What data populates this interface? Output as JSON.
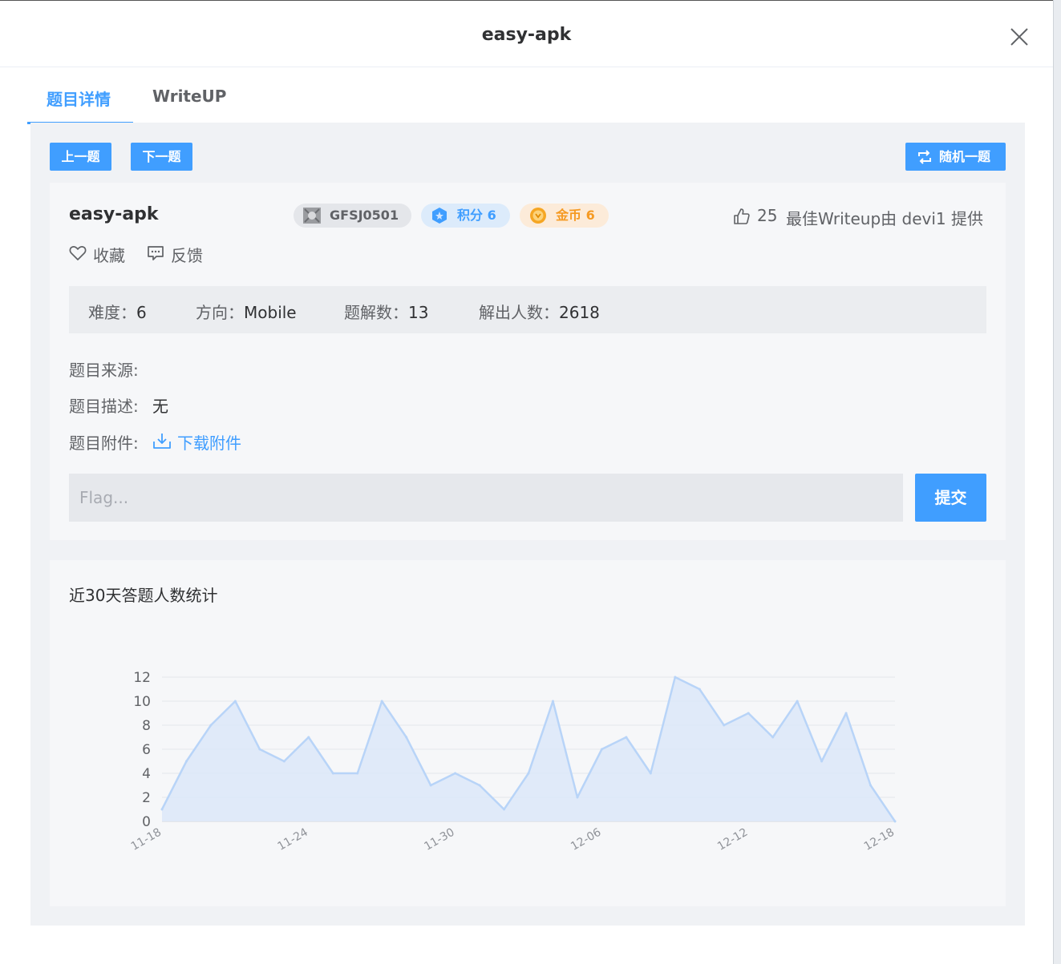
{
  "modal": {
    "title": "easy-apk",
    "close_icon": "close-icon"
  },
  "tabs": [
    {
      "label": "题目详情",
      "active": true
    },
    {
      "label": "WriteUP",
      "active": false
    }
  ],
  "toolbar": {
    "prev_label": "上一题",
    "next_label": "下一题",
    "random_label": "随机一题",
    "random_icon": "shuffle-icon"
  },
  "challenge": {
    "title": "easy-apk",
    "id_tag": "GFSJ0501",
    "score_tag": "积分 6",
    "coin_tag": "金币 6",
    "likes": "25",
    "writeup_credit": "最佳Writeup由 devi1 提供",
    "favorite_label": "收藏",
    "feedback_label": "反馈",
    "info": {
      "difficulty_label": "难度：",
      "difficulty": "6",
      "direction_label": "方向：",
      "direction": "Mobile",
      "solutions_label": "题解数：",
      "solutions": "13",
      "solvers_label": "解出人数：",
      "solvers": "2618"
    },
    "source_label": "题目来源:",
    "source": "",
    "description_label": "题目描述:",
    "description": "无",
    "attachment_label": "题目附件:",
    "download_label": "下载附件"
  },
  "flag": {
    "placeholder": "Flag...",
    "value": "",
    "submit_label": "提交"
  },
  "colors": {
    "primary": "#409eff",
    "coin": "#f59a23",
    "line": "#b8d4f8",
    "area": "#dce8f9"
  },
  "chart_title": "近30天答题人数统计",
  "chart_data": {
    "type": "area",
    "title": "",
    "x": [
      "11-18",
      "11-19",
      "11-20",
      "11-21",
      "11-22",
      "11-23",
      "11-24",
      "11-25",
      "11-26",
      "11-27",
      "11-28",
      "11-29",
      "11-30",
      "12-01",
      "12-02",
      "12-03",
      "12-04",
      "12-05",
      "12-06",
      "12-07",
      "12-08",
      "12-09",
      "12-10",
      "12-11",
      "12-12",
      "12-13",
      "12-14",
      "12-15",
      "12-16",
      "12-17",
      "12-18"
    ],
    "values": [
      1,
      5,
      8,
      10,
      6,
      5,
      7,
      4,
      4,
      10,
      7,
      3,
      4,
      3,
      1,
      4,
      10,
      2,
      6,
      7,
      4,
      12,
      11,
      8,
      9,
      7,
      10,
      5,
      9,
      3,
      0
    ],
    "xtick_labels": [
      "11-18",
      "11-24",
      "11-30",
      "12-06",
      "12-12",
      "12-18"
    ],
    "ylim": [
      0,
      12
    ],
    "yticks": [
      0,
      2,
      4,
      6,
      8,
      10,
      12
    ],
    "grid": true,
    "xlabel": "",
    "ylabel": ""
  }
}
